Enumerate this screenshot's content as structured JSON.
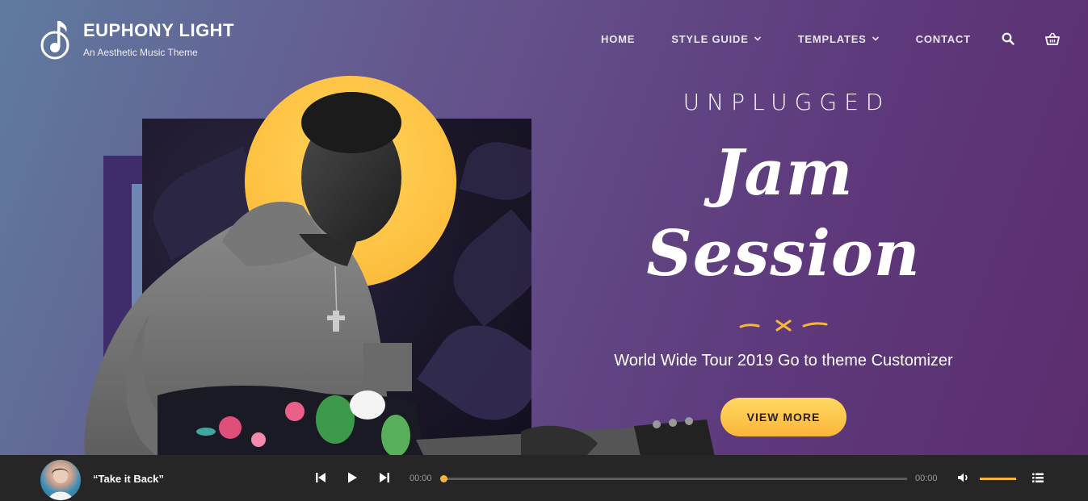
{
  "brand": {
    "title": "EUPHONY LIGHT",
    "subtitle": "An Aesthetic Music Theme",
    "logo_icon": "music-note-icon"
  },
  "nav": {
    "items": [
      {
        "label": "HOME"
      },
      {
        "label": "STYLE GUIDE",
        "dropdown": true
      },
      {
        "label": "TEMPLATES",
        "dropdown": true
      },
      {
        "label": "CONTACT"
      }
    ],
    "icons": [
      "search-icon",
      "basket-icon"
    ]
  },
  "hero": {
    "kicker": "UNPLUGGED",
    "headline": "Jam Session",
    "tagline": "World Wide Tour 2019 Go to theme Customizer",
    "cta_label": "VIEW MORE"
  },
  "player": {
    "track_title": "“Take it Back”",
    "time_current": "00:00",
    "time_total": "00:00",
    "progress": 0,
    "volume": 0.8
  },
  "colors": {
    "accent": "#fbb63a",
    "player_bg": "#262626",
    "sun": "#fdbf3f"
  }
}
